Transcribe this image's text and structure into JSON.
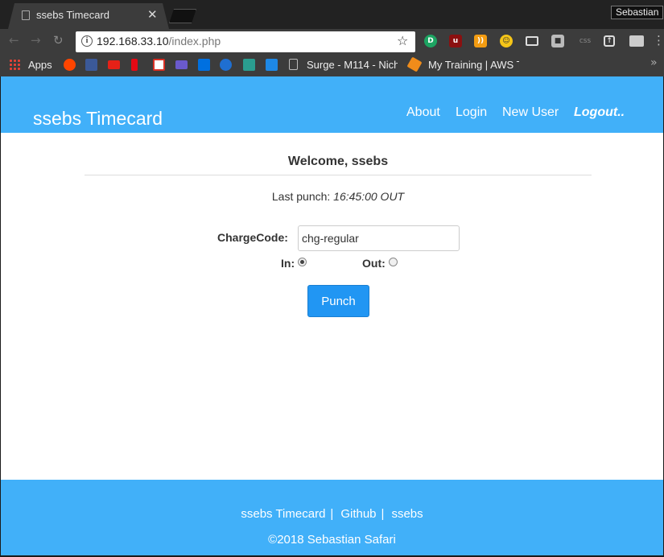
{
  "browser": {
    "tab_title": "ssebs Timecard",
    "tab_close": "✕",
    "profile_name": "Sebastian",
    "url_host": "192.168.33.10",
    "url_path": "/index.php",
    "bookmarks": {
      "apps_label": "Apps",
      "surge_label": "Surge - M114 - Nich",
      "training_label": "My Training | AWS T"
    },
    "ext_css_label": "css"
  },
  "site": {
    "brand": "ssebs Timecard",
    "nav": {
      "about": "About",
      "login": "Login",
      "new_user": "New User",
      "logout": "Logout.."
    }
  },
  "main": {
    "welcome": "Welcome, ssebs",
    "last_punch_label": "Last punch:",
    "last_punch_value": "16:45:00 OUT",
    "charge_code_label": "ChargeCode:",
    "charge_code_value": "chg-regular",
    "in_label": "In:",
    "out_label": "Out:",
    "selected_direction": "in",
    "punch_button": "Punch"
  },
  "footer": {
    "link_timecard": "ssebs Timecard",
    "link_github": "Github",
    "link_ssebs": "ssebs",
    "separator": "|",
    "copyright": "©2018 Sebastian Safari"
  },
  "colors": {
    "brand_blue": "#41b0f9",
    "button_blue": "#2196f3",
    "browser_chrome": "#3c3c3c"
  }
}
